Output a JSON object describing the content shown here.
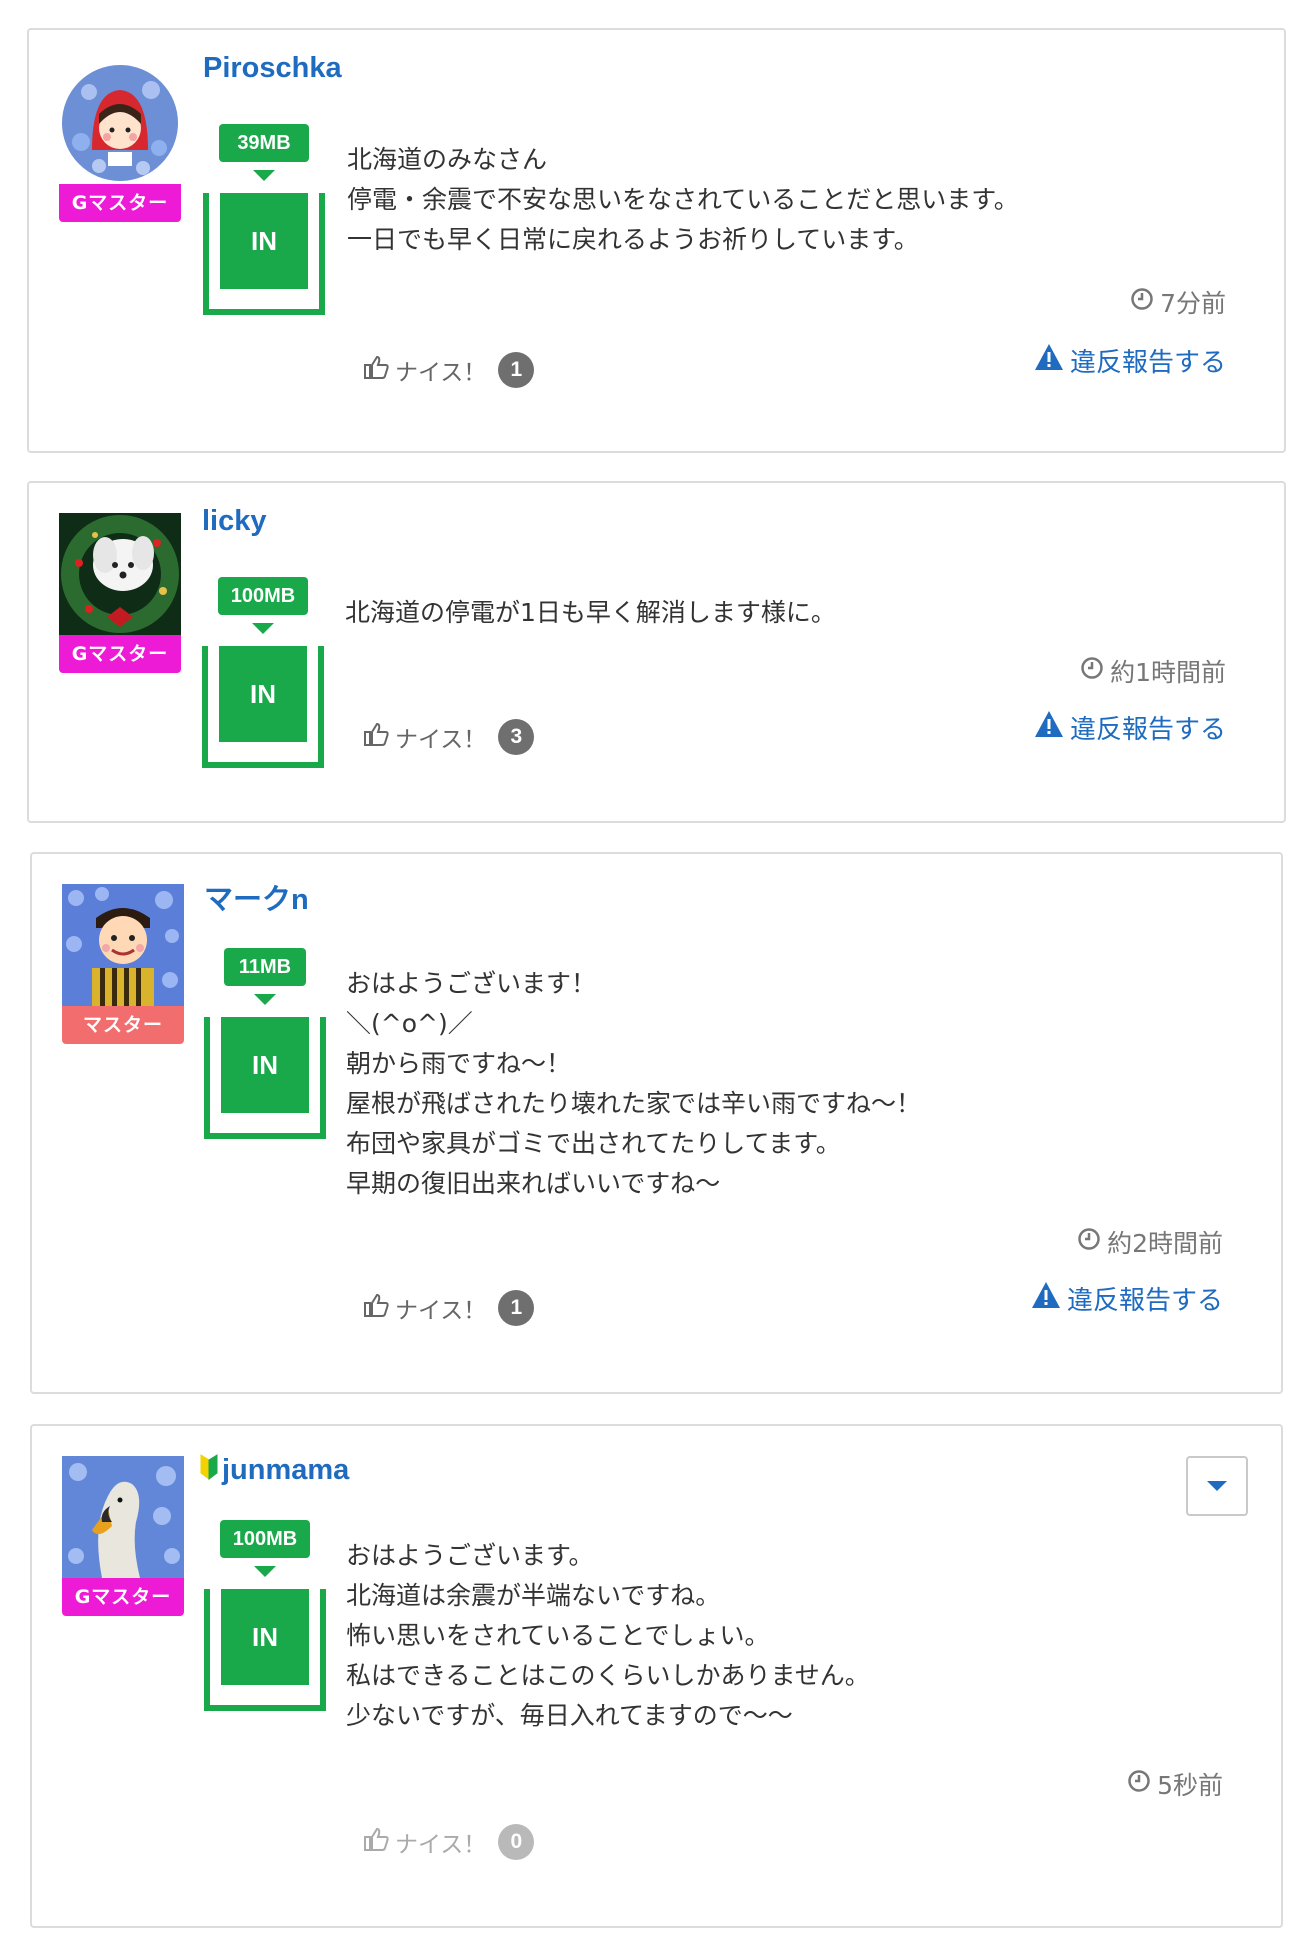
{
  "colors": {
    "username": "#1e6bbf",
    "transfer_green": "#1aa94a",
    "g_master_badge": "#ee1bd6",
    "master_badge": "#f26d6d",
    "nice_count": "#6f6f6f",
    "nice_count_zero": "#b9b9b9"
  },
  "posts": [
    {
      "username": "Piroschka",
      "avatar_icon": "red-hood-girl-avatar",
      "rank": "Gマスター",
      "transfer_size": "39MB",
      "transfer_label": "IN",
      "message": [
        "北海道のみなさん",
        "停電・余震で不安な思いをなされていることだと思います。",
        "一日でも早く日常に戻れるようお祈りしています。"
      ],
      "time": "7分前",
      "report_label": "違反報告する",
      "nice_label": "ナイス！",
      "nice_count": "1"
    },
    {
      "username": "licky",
      "avatar_icon": "dog-wreath-avatar",
      "rank": "Gマスター",
      "transfer_size": "100MB",
      "transfer_label": "IN",
      "message": [
        "北海道の停電が1日も早く解消します様に。"
      ],
      "time": "約1時間前",
      "report_label": "違反報告する",
      "nice_label": "ナイス！",
      "nice_count": "3"
    },
    {
      "username": "マークn",
      "avatar_icon": "boy-flowers-avatar",
      "rank": "マスター",
      "transfer_size": "11MB",
      "transfer_label": "IN",
      "message": [
        "おはようございます！",
        "＼(^o^)／",
        "朝から雨ですね〜！",
        "屋根が飛ばされたり壊れた家では辛い雨ですね〜！",
        "布団や家具がゴミで出されてたりしてます。",
        "早期の復旧出来ればいいですね〜"
      ],
      "time": "約2時間前",
      "report_label": "違反報告する",
      "nice_label": "ナイス！",
      "nice_count": "1"
    },
    {
      "username": "junmama",
      "avatar_icon": "swan-avatar",
      "username_icon": "beginner-mark-icon",
      "rank": "Gマスター",
      "transfer_size": "100MB",
      "transfer_label": "IN",
      "message": [
        "おはようございます。",
        "北海道は余震が半端ないですね。",
        "怖い思いをされていることでしょい。",
        "私はできることはこのくらいしかありません。",
        "少ないですが、毎日入れてますので〜〜"
      ],
      "time": "5秒前",
      "nice_label": "ナイス！",
      "nice_count": "0",
      "menu_icon": "chevron-down-icon"
    }
  ]
}
